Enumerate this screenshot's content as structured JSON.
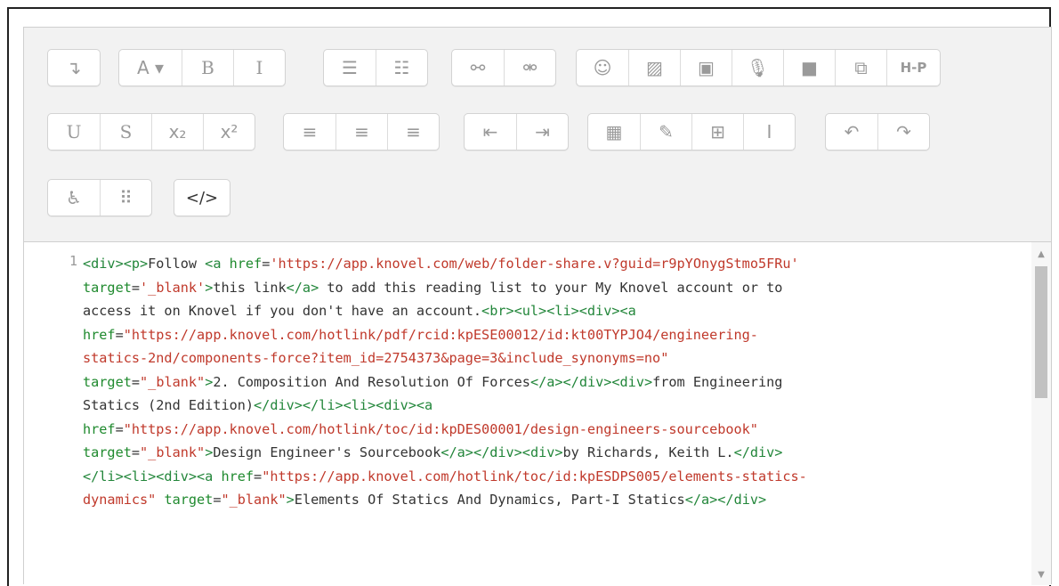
{
  "toolbar": {
    "rows": [
      [
        [
          {
            "name": "show-more-button",
            "glyph": "↴"
          }
        ],
        [
          {
            "name": "font-color-button",
            "glyph": "A ▾"
          },
          {
            "name": "bold-button",
            "glyph": "B"
          },
          {
            "name": "italic-button",
            "glyph": "I"
          }
        ],
        [
          {
            "name": "unordered-list-button",
            "glyph": "☰"
          },
          {
            "name": "ordered-list-button",
            "glyph": "☷"
          }
        ],
        [
          {
            "name": "link-button",
            "glyph": "⚯"
          },
          {
            "name": "unlink-button",
            "glyph": "⚮"
          }
        ],
        [
          {
            "name": "emoji-button",
            "glyph": "☺"
          },
          {
            "name": "image-button",
            "glyph": "▨"
          },
          {
            "name": "media-button",
            "glyph": "▣"
          },
          {
            "name": "record-audio-button",
            "glyph": "🎙"
          },
          {
            "name": "record-video-button",
            "glyph": "■"
          },
          {
            "name": "manage-files-button",
            "glyph": "⧉"
          },
          {
            "name": "h5p-button",
            "glyph": "H-P"
          }
        ]
      ],
      [
        [
          {
            "name": "underline-button",
            "glyph": "U"
          },
          {
            "name": "strikethrough-button",
            "glyph": "S"
          },
          {
            "name": "subscript-button",
            "glyph": "x₂"
          },
          {
            "name": "superscript-button",
            "glyph": "x²"
          }
        ],
        [
          {
            "name": "align-left-button",
            "glyph": "≡"
          },
          {
            "name": "align-center-button",
            "glyph": "≡"
          },
          {
            "name": "align-right-button",
            "glyph": "≡"
          }
        ],
        [
          {
            "name": "outdent-button",
            "glyph": "⇤"
          },
          {
            "name": "indent-button",
            "glyph": "⇥"
          }
        ],
        [
          {
            "name": "equation-button",
            "glyph": "▦"
          },
          {
            "name": "special-character-button",
            "glyph": "✎"
          },
          {
            "name": "table-button",
            "glyph": "⊞"
          },
          {
            "name": "clear-formatting-button",
            "glyph": "Ⅰ"
          }
        ],
        [
          {
            "name": "undo-button",
            "glyph": "↶"
          },
          {
            "name": "redo-button",
            "glyph": "↷"
          }
        ]
      ],
      [
        [
          {
            "name": "accessibility-checker-button",
            "glyph": "♿"
          },
          {
            "name": "screenreader-helper-button",
            "glyph": "⠿"
          }
        ],
        [
          {
            "name": "html-source-button",
            "glyph": "</>"
          }
        ]
      ]
    ]
  },
  "code": {
    "line_number": "1",
    "lines": [
      [
        [
          "t",
          "<div><p>"
        ],
        [
          "x",
          "Follow "
        ],
        [
          "t",
          "<a "
        ],
        [
          "a",
          "href"
        ],
        [
          "x",
          "="
        ],
        [
          "s",
          "'https://app.knovel.com/web/folder-share.v?guid=r9pYOnygStmo5FRu'"
        ]
      ],
      [
        [
          "a",
          "target"
        ],
        [
          "x",
          "="
        ],
        [
          "s",
          "'_blank'"
        ],
        [
          "t",
          ">"
        ],
        [
          "x",
          "this link"
        ],
        [
          "t",
          "</a>"
        ],
        [
          "x",
          " to add this reading list to your My Knovel account or to"
        ]
      ],
      [
        [
          "x",
          "access it on Knovel if you don't have an account."
        ],
        [
          "t",
          "<br><ul><li><div><a"
        ]
      ],
      [
        [
          "a",
          "href"
        ],
        [
          "x",
          "="
        ],
        [
          "s",
          "\"https://app.knovel.com/hotlink/pdf/rcid:kpESE00012/id:kt00TYPJO4/engineering-"
        ]
      ],
      [
        [
          "s",
          "statics-2nd/components-force?item_id=2754373&page=3&include_synonyms=no\""
        ]
      ],
      [
        [
          "a",
          "target"
        ],
        [
          "x",
          "="
        ],
        [
          "s",
          "\"_blank\""
        ],
        [
          "t",
          ">"
        ],
        [
          "x",
          "2. Composition And Resolution Of Forces"
        ],
        [
          "t",
          "</a></div><div>"
        ],
        [
          "x",
          "from Engineering"
        ]
      ],
      [
        [
          "x",
          "Statics (2nd Edition)"
        ],
        [
          "t",
          "</div></li><li><div><a"
        ]
      ],
      [
        [
          "a",
          "href"
        ],
        [
          "x",
          "="
        ],
        [
          "s",
          "\"https://app.knovel.com/hotlink/toc/id:kpDES00001/design-engineers-sourcebook\""
        ]
      ],
      [
        [
          "a",
          "target"
        ],
        [
          "x",
          "="
        ],
        [
          "s",
          "\"_blank\""
        ],
        [
          "t",
          ">"
        ],
        [
          "x",
          "Design Engineer's Sourcebook"
        ],
        [
          "t",
          "</a></div><div>"
        ],
        [
          "x",
          "by Richards, Keith L."
        ],
        [
          "t",
          "</div>"
        ]
      ],
      [
        [
          "t",
          "</li><li><div><a "
        ],
        [
          "a",
          "href"
        ],
        [
          "x",
          "="
        ],
        [
          "s",
          "\"https://app.knovel.com/hotlink/toc/id:kpESDPS005/elements-statics-"
        ]
      ],
      [
        [
          "s",
          "dynamics\""
        ],
        [
          "x",
          " "
        ],
        [
          "a",
          "target"
        ],
        [
          "x",
          "="
        ],
        [
          "s",
          "\"_blank\""
        ],
        [
          "t",
          ">"
        ],
        [
          "x",
          "Elements Of Statics And Dynamics, Part-I Statics"
        ],
        [
          "t",
          "</a></div>"
        ]
      ]
    ]
  }
}
